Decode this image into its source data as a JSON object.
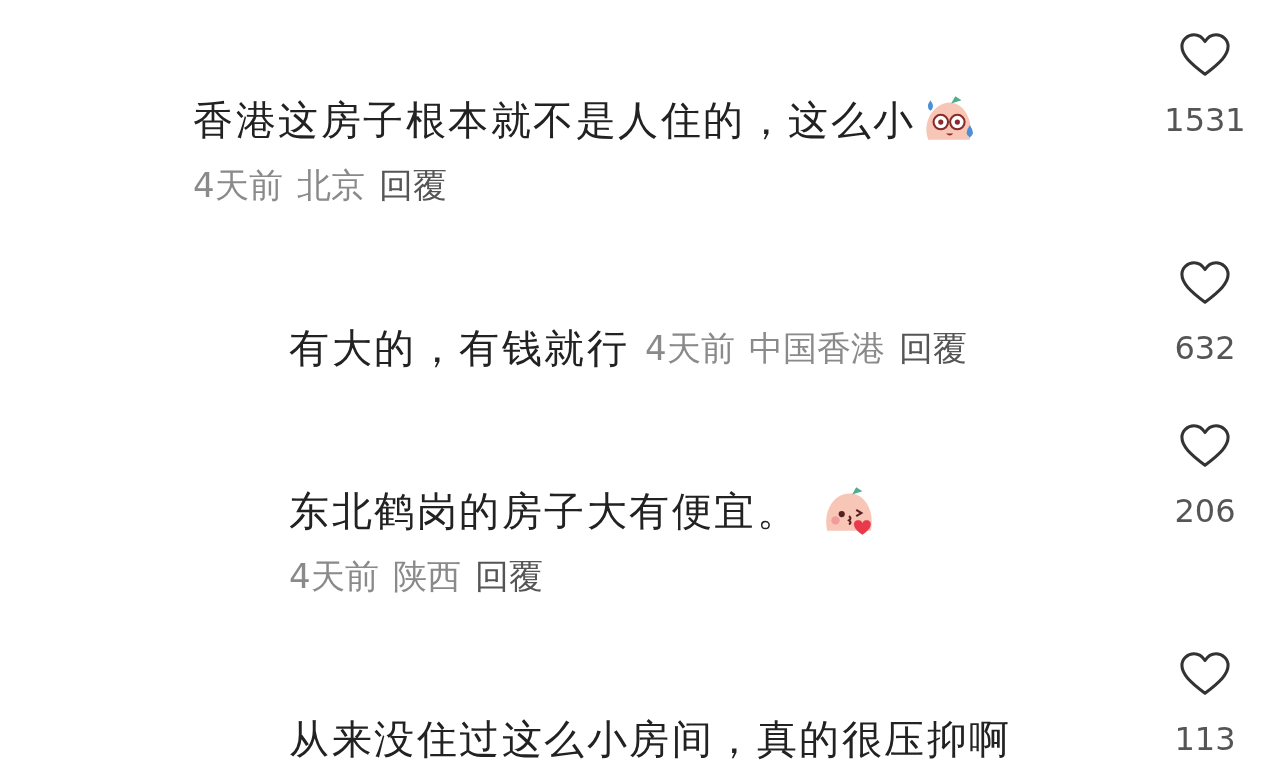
{
  "comments": [
    {
      "text": "香港这房子根本就不是人住的，这么小",
      "emoji": {
        "kind": "sweat"
      },
      "kind": "stacked",
      "time": "4天前",
      "location": "北京",
      "reply": "回覆",
      "likes": "1531",
      "children": [
        {
          "text": "有大的，有钱就行",
          "kind": "inline",
          "time": "4天前",
          "location": "中国香港",
          "reply": "回覆",
          "likes": "632"
        },
        {
          "text": "东北鹤岗的房子大有便宜。",
          "emoji": {
            "kind": "kiss"
          },
          "kind": "stacked",
          "time": "4天前",
          "location": "陕西",
          "reply": "回覆",
          "likes": "206"
        },
        {
          "text": "从来没住过这么小房间，真的很压抑啊",
          "kind": "stacked",
          "likes": "113"
        }
      ]
    }
  ]
}
